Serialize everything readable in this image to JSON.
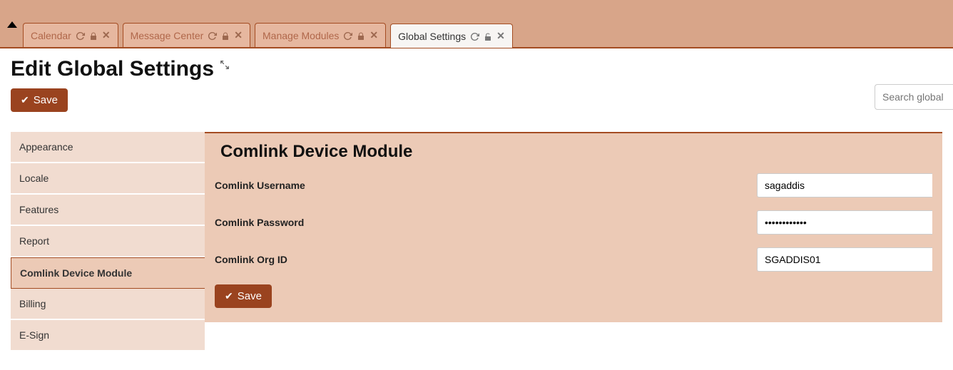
{
  "tabs": [
    {
      "label": "Calendar"
    },
    {
      "label": "Message Center"
    },
    {
      "label": "Manage Modules"
    },
    {
      "label": "Global Settings"
    }
  ],
  "page": {
    "title": "Edit Global Settings",
    "save_label": "Save",
    "search_placeholder": "Search global se"
  },
  "sidebar": {
    "items": [
      {
        "label": "Appearance"
      },
      {
        "label": "Locale"
      },
      {
        "label": "Features"
      },
      {
        "label": "Report"
      },
      {
        "label": "Comlink Device Module"
      },
      {
        "label": "Billing"
      },
      {
        "label": "E-Sign"
      }
    ]
  },
  "panel": {
    "title": "Comlink Device Module",
    "fields": {
      "username": {
        "label": "Comlink Username",
        "value": "sagaddis"
      },
      "password": {
        "label": "Comlink Password",
        "value": "••••••••••••"
      },
      "orgid": {
        "label": "Comlink Org ID",
        "value": "SGADDIS01"
      }
    },
    "save_label": "Save"
  }
}
